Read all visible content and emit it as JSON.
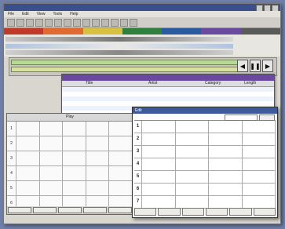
{
  "window": {
    "title": ""
  },
  "menu": [
    "File",
    "Edit",
    "View",
    "Tools",
    "Help"
  ],
  "toolbar_count": 14,
  "colors": {
    "accent": "#3b4f8c",
    "colorbar": [
      "#c03a2a",
      "#e06a30",
      "#d8c040",
      "#2f7f3f",
      "#2a5aa0",
      "#6a4aa0",
      "#5a5a5a"
    ],
    "green": "#b8d89a",
    "purple": "#6a4aa0"
  },
  "transport": {
    "prev": "◀",
    "pause": "❚❚",
    "play": "▶"
  },
  "library": {
    "title": "",
    "columns": [
      "",
      "Title",
      "Artist",
      "Category",
      "Length"
    ],
    "rows": [
      [
        "",
        "",
        "",
        "",
        ""
      ],
      [
        "",
        "",
        "",
        "",
        ""
      ],
      [
        "",
        "",
        "",
        "",
        ""
      ],
      [
        "",
        "",
        "",
        "",
        ""
      ],
      [
        "",
        "",
        "",
        "",
        ""
      ],
      [
        "",
        "",
        "",
        "",
        ""
      ],
      [
        "",
        "",
        "",
        "",
        ""
      ],
      [
        "",
        "",
        "",
        "",
        ""
      ]
    ]
  },
  "left_grid": {
    "title": "",
    "header": "Play",
    "row_numbers": [
      "1",
      "2",
      "3",
      "4",
      "5",
      "6"
    ],
    "buttons": [
      "",
      "",
      "",
      "",
      ""
    ]
  },
  "dialog": {
    "title": "Edit",
    "row_numbers": [
      "1",
      "2",
      "3",
      "4",
      "5",
      "6",
      "7"
    ],
    "cells": [
      [
        "",
        "",
        "",
        ""
      ],
      [
        "",
        "",
        "",
        ""
      ],
      [
        "",
        "",
        "",
        ""
      ],
      [
        "",
        "",
        "",
        ""
      ],
      [
        "",
        "",
        "",
        ""
      ],
      [
        "",
        "",
        "",
        ""
      ],
      [
        "",
        "",
        "",
        ""
      ]
    ],
    "buttons": [
      "",
      "",
      "",
      "",
      "",
      ""
    ]
  },
  "status_text": ""
}
